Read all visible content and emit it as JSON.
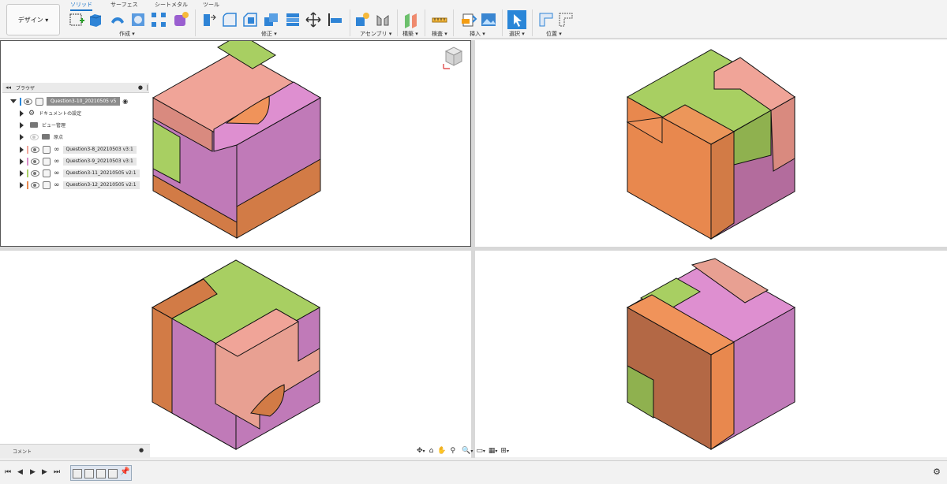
{
  "toolbar": {
    "workspace_button": "デザイン ▾",
    "tabs": [
      "ソリッド",
      "サーフェス",
      "シートメタル",
      "ツール"
    ],
    "groups": [
      "作成 ▾",
      "修正 ▾",
      "アセンブリ ▾",
      "構築 ▾",
      "検査 ▾",
      "挿入 ▾",
      "選択 ▾",
      "位置 ▾"
    ]
  },
  "browser": {
    "title": "ブラウザ",
    "root_label": "Question3-10_20210505 v5",
    "items": [
      {
        "label": "ドキュメントの設定"
      },
      {
        "label": "ビュー管理"
      },
      {
        "label": "原点"
      },
      {
        "label": "Question3-8_20210503 v3:1"
      },
      {
        "label": "Question3-9_20210503 v3:1"
      },
      {
        "label": "Question3-11_20210505 v2:1"
      },
      {
        "label": "Question3-12_20210505 v2:1"
      }
    ]
  },
  "comments": {
    "label": "コメント"
  },
  "colors": {
    "salmon": "#f2a79c",
    "green": "#a9d065",
    "magenta": "#d98cc8",
    "orange": "#e8884e",
    "orange_dark": "#c97740",
    "violet": "#c07ab8",
    "brown": "#b36845",
    "accent": "#1a73c8"
  },
  "cube_colors": {
    "pink_top": "#f0a498",
    "pink_side": "#d98a7f",
    "green_top": "#a8cf62",
    "green_side": "#8fb14f",
    "violet_top": "#de8fd0",
    "violet_side": "#c27abb",
    "orange_top": "#f0935a",
    "orange_side": "#d27b46",
    "orange_dark": "#b36845"
  }
}
